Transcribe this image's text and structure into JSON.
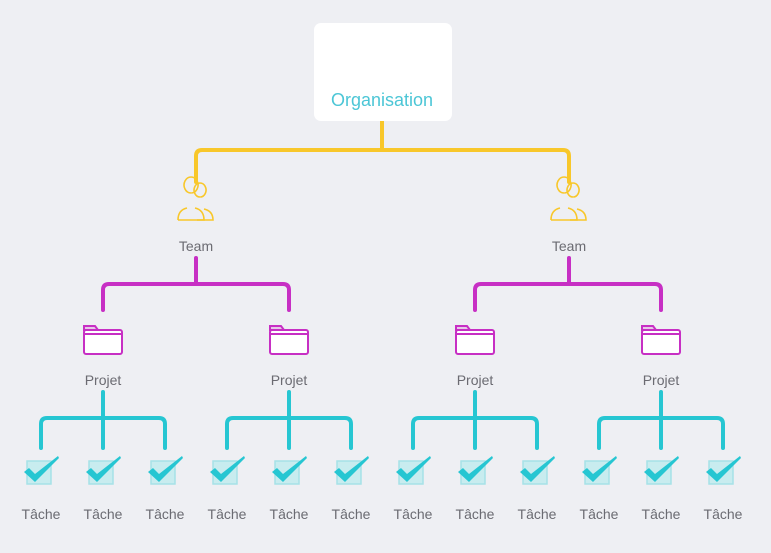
{
  "colors": {
    "organisation": "#4cc6d6",
    "team": "#f8c72a",
    "project": "#c72fc4",
    "task": "#26c6d2",
    "text": "#6b6b72"
  },
  "icons": {
    "organisation": "house-icon",
    "team": "users-icon",
    "project": "folder-icon",
    "task": "checkbox-checked-icon"
  },
  "tree": {
    "label": "Organisation",
    "children": [
      {
        "label": "Team",
        "children": [
          {
            "label": "Projet",
            "children": [
              {
                "label": "Tâche"
              },
              {
                "label": "Tâche"
              },
              {
                "label": "Tâche"
              }
            ]
          },
          {
            "label": "Projet",
            "children": [
              {
                "label": "Tâche"
              },
              {
                "label": "Tâche"
              },
              {
                "label": "Tâche"
              }
            ]
          }
        ]
      },
      {
        "label": "Team",
        "children": [
          {
            "label": "Projet",
            "children": [
              {
                "label": "Tâche"
              },
              {
                "label": "Tâche"
              },
              {
                "label": "Tâche"
              }
            ]
          },
          {
            "label": "Projet",
            "children": [
              {
                "label": "Tâche"
              },
              {
                "label": "Tâche"
              },
              {
                "label": "Tâche"
              }
            ]
          }
        ]
      }
    ]
  }
}
